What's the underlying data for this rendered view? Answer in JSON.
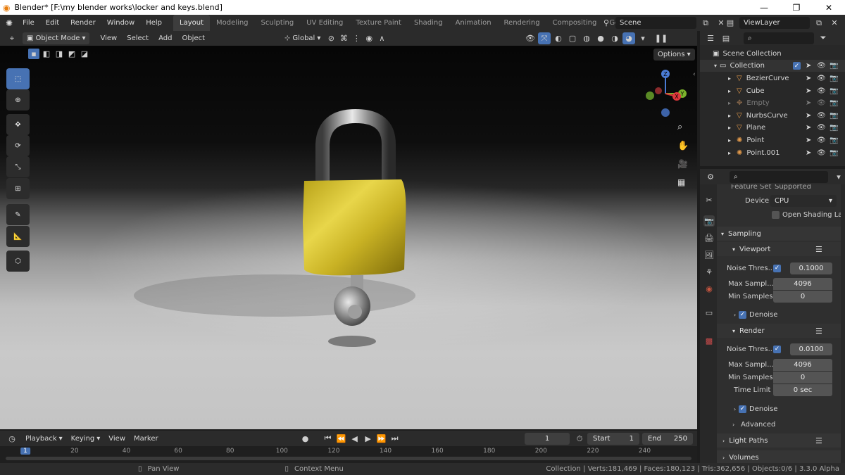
{
  "window": {
    "title": "Blender* [F:\\my blender works\\locker and keys.blend]",
    "minimize": "—",
    "maximize": "❐",
    "close": "✕"
  },
  "menu": [
    "File",
    "Edit",
    "Render",
    "Window",
    "Help"
  ],
  "workspaces": [
    {
      "label": "Layout",
      "active": true
    },
    {
      "label": "Modeling",
      "active": false
    },
    {
      "label": "Sculpting",
      "active": false
    },
    {
      "label": "UV Editing",
      "active": false
    },
    {
      "label": "Texture Paint",
      "active": false
    },
    {
      "label": "Shading",
      "active": false
    },
    {
      "label": "Animation",
      "active": false
    },
    {
      "label": "Rendering",
      "active": false
    },
    {
      "label": "Compositing",
      "active": false
    },
    {
      "label": "Geometry Noc",
      "active": false
    }
  ],
  "scene": "Scene",
  "view_layer": "ViewLayer",
  "viewport_header": {
    "mode": "Object Mode",
    "menus": [
      "View",
      "Select",
      "Add",
      "Object"
    ],
    "orientation": "Global",
    "options": "Options"
  },
  "gizmo": {
    "z": "Z",
    "y": "Y",
    "x": "X"
  },
  "outliner": {
    "root": "Scene Collection",
    "collection": "Collection",
    "items": [
      {
        "name": "BezierCurve",
        "icon": "curve-icon",
        "color": "#e39a4b",
        "dim": false
      },
      {
        "name": "Cube",
        "icon": "mesh-icon",
        "color": "#e39a4b",
        "dim": false
      },
      {
        "name": "Empty",
        "icon": "empty-icon",
        "color": "#8d6b4c",
        "dim": true
      },
      {
        "name": "NurbsCurve",
        "icon": "curve-icon",
        "color": "#e39a4b",
        "dim": false
      },
      {
        "name": "Plane",
        "icon": "mesh-icon",
        "color": "#e39a4b",
        "dim": false
      },
      {
        "name": "Point",
        "icon": "light-icon",
        "color": "#e39a4b",
        "dim": false
      },
      {
        "name": "Point.001",
        "icon": "light-icon",
        "color": "#e39a4b",
        "dim": false
      }
    ]
  },
  "properties": {
    "feature_set_label": "Feature Set",
    "feature_set_value": "Supported",
    "device_label": "Device",
    "device_value": "CPU",
    "open_shading": "Open Shading La...",
    "sampling": "Sampling",
    "viewport": "Viewport",
    "vp_noise_label": "Noise Thres...",
    "vp_noise_value": "0.1000",
    "vp_max_label": "Max Sampl...",
    "vp_max_value": "4096",
    "vp_min_label": "Min Samples",
    "vp_min_value": "0",
    "denoise": "Denoise",
    "render": "Render",
    "r_noise_label": "Noise Thres...",
    "r_noise_value": "0.0100",
    "r_max_label": "Max Sampl...",
    "r_max_value": "4096",
    "r_min_label": "Min Samples",
    "r_min_value": "0",
    "time_limit_label": "Time Limit",
    "time_limit_value": "0 sec",
    "denoise2": "Denoise",
    "advanced": "Advanced",
    "light_paths": "Light Paths",
    "volumes": "Volumes"
  },
  "timeline": {
    "menus": [
      "Playback",
      "Keying",
      "View",
      "Marker"
    ],
    "current_frame": "1",
    "start_label": "Start",
    "start_value": "1",
    "end_label": "End",
    "end_value": "250",
    "ruler": [
      "1",
      "20",
      "40",
      "60",
      "80",
      "100",
      "120",
      "140",
      "160",
      "180",
      "200",
      "220",
      "240"
    ]
  },
  "status": {
    "pan": "Pan View",
    "context": "Context Menu",
    "info": "Collection | Verts:181,469 | Faces:180,123 | Tris:362,656 | Objects:0/6 | 3.3.0 Alpha"
  }
}
